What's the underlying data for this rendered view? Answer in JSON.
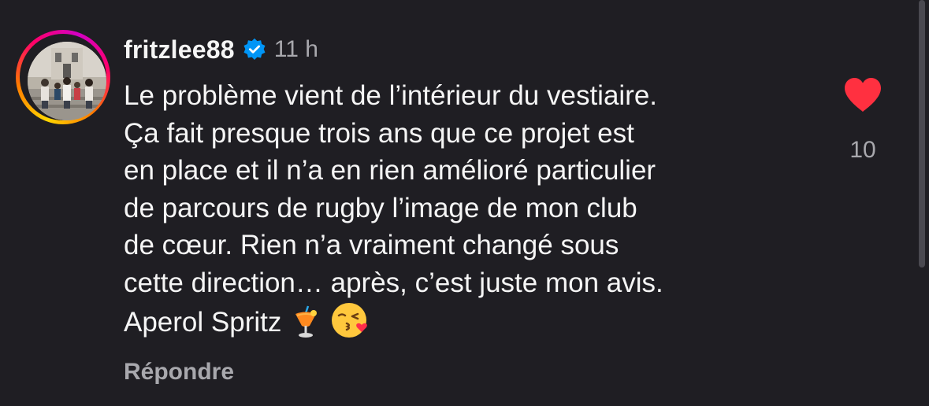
{
  "comment": {
    "username": "fritzlee88",
    "verified": true,
    "time": "11 h",
    "lines": [
      "Le problème vient de l’intérieur du vestiaire.",
      "Ça fait presque trois ans que ce projet est",
      "en place et il n’a en rien amélioré particulier",
      "de parcours de rugby l’image de mon club",
      "de cœur. Rien n’a vraiment changé sous",
      "cette direction… après, c’est juste mon avis.",
      "Aperol Spritz"
    ],
    "emojis": [
      "tropical-drink",
      "kissing-heart-face"
    ],
    "reply_label": "Répondre",
    "like_count": "10",
    "liked": true
  },
  "colors": {
    "background": "#1f1e23",
    "text": "#f5f5f5",
    "muted": "#a8a8ad",
    "like_red": "#ff3040",
    "verified_blue": "#0095f6"
  }
}
